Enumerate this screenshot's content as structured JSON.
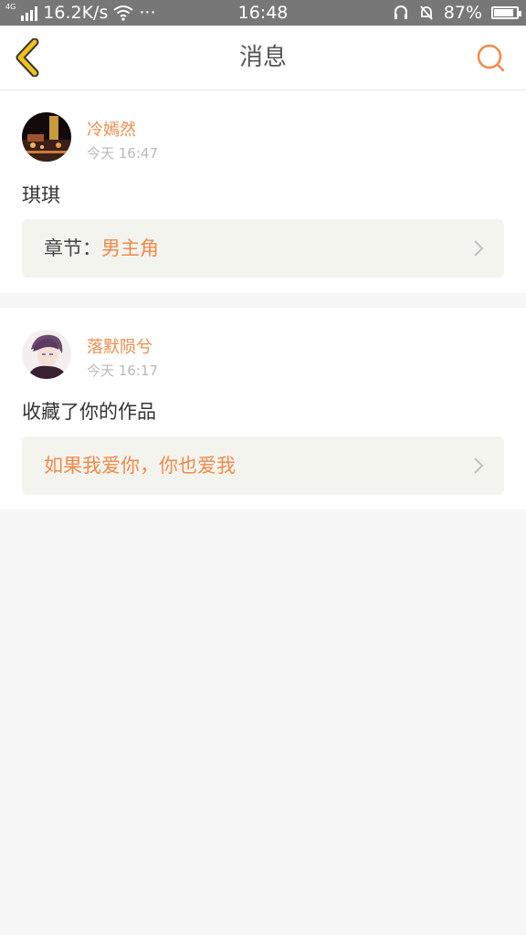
{
  "status_bar": {
    "network_type": "4G",
    "speed": "16.2K/s",
    "more": "···",
    "time": "16:48",
    "battery": "87%",
    "battery_level": 0.87
  },
  "header": {
    "title": "消息"
  },
  "messages": [
    {
      "username": "冷嫣然",
      "time": "今天 16:47",
      "text": "琪琪",
      "ref_label": "章节：",
      "ref_value": "男主角"
    },
    {
      "username": "落默陨兮",
      "time": "今天 16:17",
      "text": "收藏了你的作品",
      "ref_label": "",
      "ref_value": "如果我爱你，你也爱我"
    }
  ],
  "colors": {
    "accent": "#f08a4b",
    "back_icon": "#f2c21b",
    "status_bar": "#777777",
    "page_bg": "#f7f7f7",
    "ref_box_bg": "#f4f4ef"
  }
}
